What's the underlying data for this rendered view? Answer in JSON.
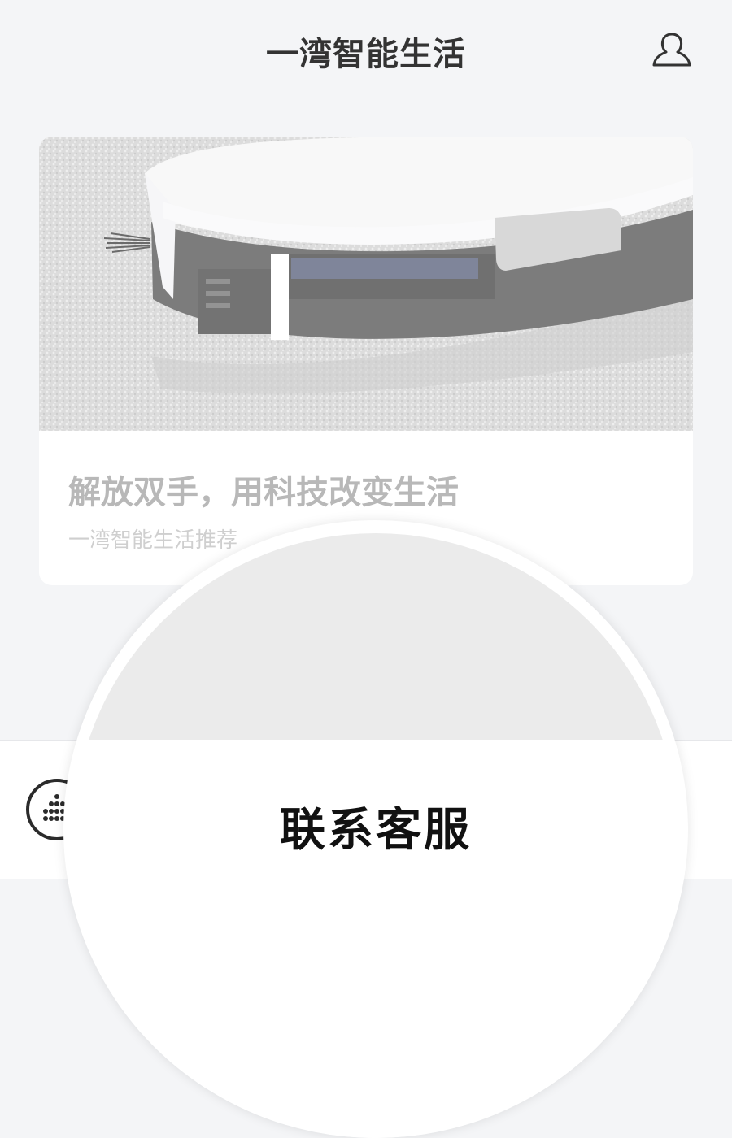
{
  "header": {
    "title": "一湾智能生活",
    "profile_icon": "user-icon"
  },
  "card": {
    "image_subject": "robot-vacuum-on-carpet",
    "title": "解放双手，用科技改变生活",
    "subtitle": "一湾智能生活推荐"
  },
  "bottom": {
    "menu_icon": "grid-dots-icon"
  },
  "popup": {
    "contact_label": "联系客服"
  },
  "colors": {
    "background": "#f4f5f7",
    "header_text": "#333333",
    "card_title": "#b8b8b8",
    "card_subtitle": "#cfcfcf",
    "popup_gray": "#ebebeb"
  }
}
